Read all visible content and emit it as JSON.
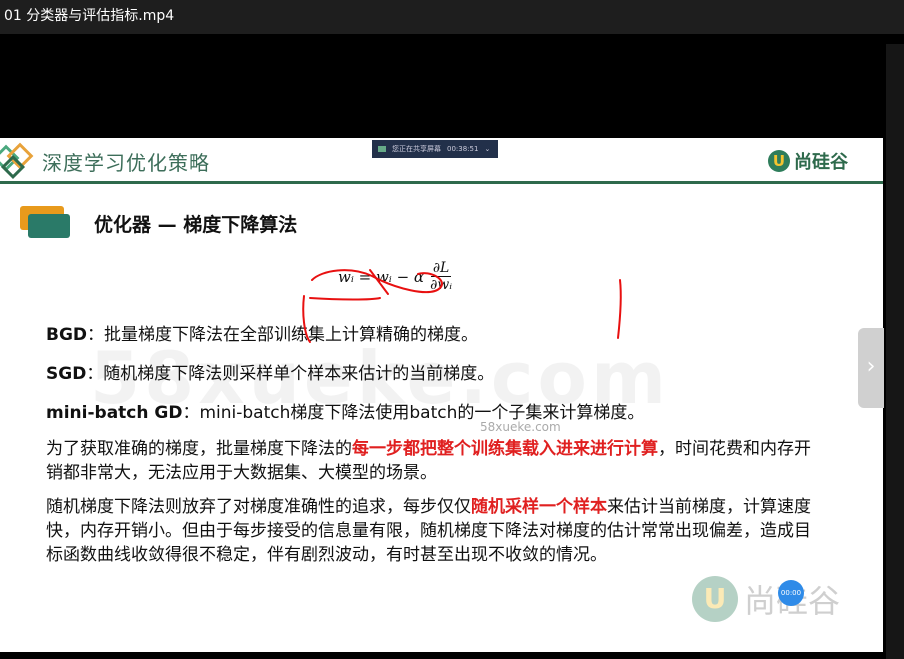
{
  "window": {
    "title": "01 分类器与评估指标.mp4"
  },
  "share_bar": {
    "text": "您正在共享屏幕",
    "time": "00:38:51"
  },
  "slide": {
    "header_title": "深度学习优化策略",
    "logo_text": "尚硅谷",
    "section_title": "优化器 — 梯度下降算法",
    "formula": {
      "lhs": "wᵢ = wᵢ − α",
      "num": "∂L",
      "den": "∂wᵢ"
    },
    "bgd": {
      "label": "BGD",
      "text": "：批量梯度下降法在全部训练集上计算精确的梯度。"
    },
    "sgd": {
      "label": "SGD",
      "text": "：随机梯度下降法则采样单个样本来估计的当前梯度。"
    },
    "mbgd": {
      "label": "mini-batch GD",
      "text": "：mini-batch梯度下降法使用batch的一个子集来计算梯度。"
    },
    "para1": {
      "pre": "为了获取准确的梯度，批量梯度下降法的",
      "red": "每一步都把整个训练集载入进来进行计算",
      "post": "，时间花费和内存开销都非常大，无法应用于大数据集、大模型的场景。"
    },
    "para2": {
      "pre": "随机梯度下降法则放弃了对梯度准确性的追求，每步仅仅",
      "red": "随机采样一个样本",
      "post": "来估计当前梯度，计算速度快，内存开销小。但由于每步接受的信息量有限，随机梯度下降法对梯度的估计常常出现偏差，造成目标函数曲线收敛得很不稳定，伴有剧烈波动，有时甚至出现不收敛的情况。"
    },
    "watermark": "58xueke.com",
    "watermark_small": "58xueke.com",
    "bottom_logo_text": "尚硅谷",
    "timer": "00:00"
  },
  "colors": {
    "accent_green": "#2e6a4c",
    "highlight_red": "#e02020",
    "annotation_red": "#e81010"
  },
  "icons": {
    "next": "chevron-right-icon",
    "logo": "atguigu-logo-icon",
    "section": "section-cards-icon"
  }
}
